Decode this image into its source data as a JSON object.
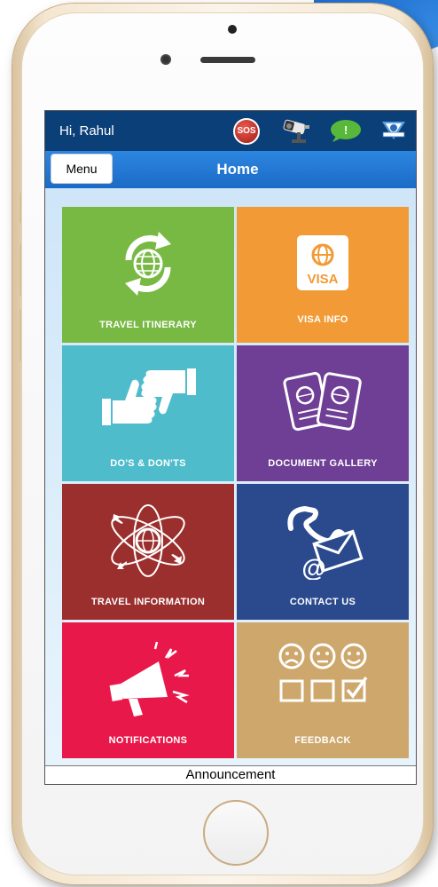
{
  "status_bar": {
    "greeting": "Hi, Rahul",
    "sos_label": "SOS",
    "icons": [
      "sos-icon",
      "cctv-camera-icon",
      "chat-bubble-icon",
      "shield-logo-icon"
    ]
  },
  "header": {
    "menu_label": "Menu",
    "title": "Home"
  },
  "tiles": [
    {
      "label": "TRAVEL ITINERARY",
      "icon": "globe-cycle-icon",
      "color": "#78b944"
    },
    {
      "label": "VISA INFO",
      "icon": "visa-icon",
      "visa_text": "VISA",
      "color": "#f29a35"
    },
    {
      "label": "DO'S & DON'TS",
      "icon": "thumbs-icon",
      "color": "#4fbccb"
    },
    {
      "label": "DOCUMENT GALLERY",
      "icon": "passports-icon",
      "color": "#6e3f95"
    },
    {
      "label": "TRAVEL INFORMATION",
      "icon": "orbit-globe-icon",
      "color": "#9a2f2d"
    },
    {
      "label": "CONTACT US",
      "icon": "phone-mail-icon",
      "color": "#2a4a8d"
    },
    {
      "label": "NOTIFICATIONS",
      "icon": "megaphone-icon",
      "color": "#e8194a"
    },
    {
      "label": "FEEDBACK",
      "icon": "feedback-faces-icon",
      "color": "#cda76b"
    }
  ],
  "announcement": "Announcement"
}
